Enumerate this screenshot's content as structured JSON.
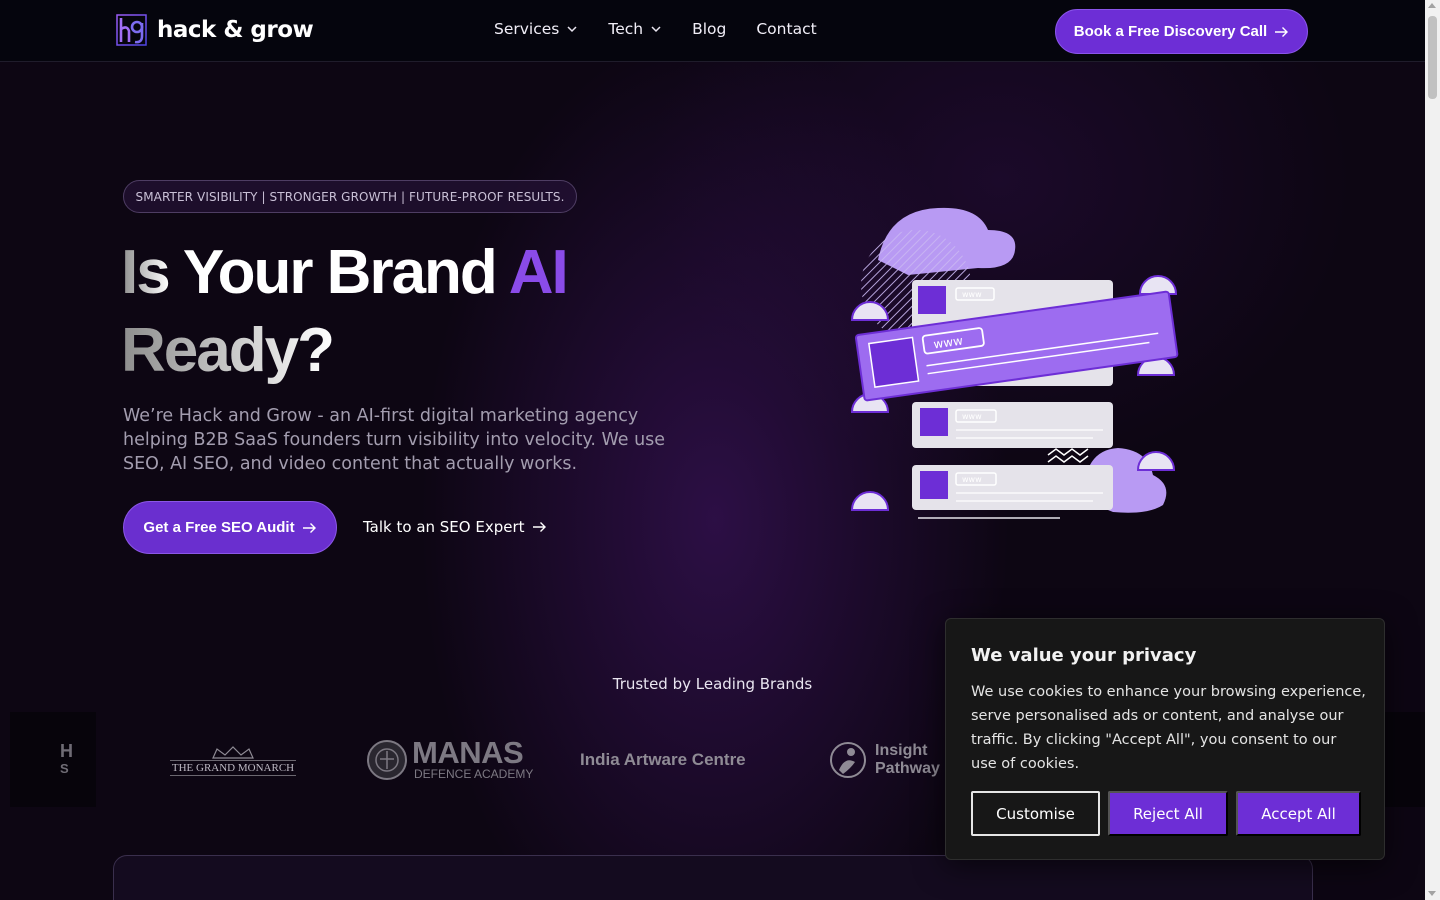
{
  "header": {
    "logo_text": "hack & grow",
    "nav": [
      {
        "label": "Services",
        "has_dropdown": true
      },
      {
        "label": "Tech",
        "has_dropdown": true
      },
      {
        "label": "Blog",
        "has_dropdown": false
      },
      {
        "label": "Contact",
        "has_dropdown": false
      }
    ],
    "cta_label": "Book a Free Discovery Call"
  },
  "hero": {
    "tagline": "SMARTER VISIBILITY | STRONGER GROWTH | FUTURE-PROOF RESULTS.",
    "headline": {
      "line1_lead": "Is",
      "line1_mid": " Your Brand ",
      "line1_accent": "AI",
      "line2": "Ready?"
    },
    "description": "We’re Hack and Grow - an AI-first digital marketing agency helping B2B SaaS founders turn visibility into velocity. We use SEO, AI SEO, and video content that actually works.",
    "primary_cta": "Get a Free SEO Audit",
    "secondary_cta": "Talk to an SEO Expert",
    "illustration_labels": {
      "www": "www"
    }
  },
  "trusted": {
    "title": "Trusted by Leading Brands",
    "brands": [
      {
        "name": "The Grand Monarch",
        "text": "THE GRAND MONARCH"
      },
      {
        "name": "Manas Defence Academy",
        "text_main": "MANAS",
        "text_sub": "DEFENCE ACADEMY"
      },
      {
        "name": "India Artware Centre",
        "text": "India Artware Centre"
      },
      {
        "name": "Insight Pathway",
        "text_line1": "Insight",
        "text_line2": "Pathway"
      }
    ],
    "partial_brand_text": {
      "line1": "H",
      "line2": "S"
    }
  },
  "cookie": {
    "title": "We value your privacy",
    "body": "We use cookies to enhance your browsing experience, serve personalised ads or content, and analyse our traffic. By clicking \"Accept All\", you consent to our use of cookies.",
    "customise_label": "Customise",
    "reject_label": "Reject All",
    "accept_label": "Accept All"
  },
  "colors": {
    "accent": "#6d2ed6",
    "accent_light": "#8a4be8",
    "background": "#0d0613",
    "header_bg": "#05050d"
  }
}
